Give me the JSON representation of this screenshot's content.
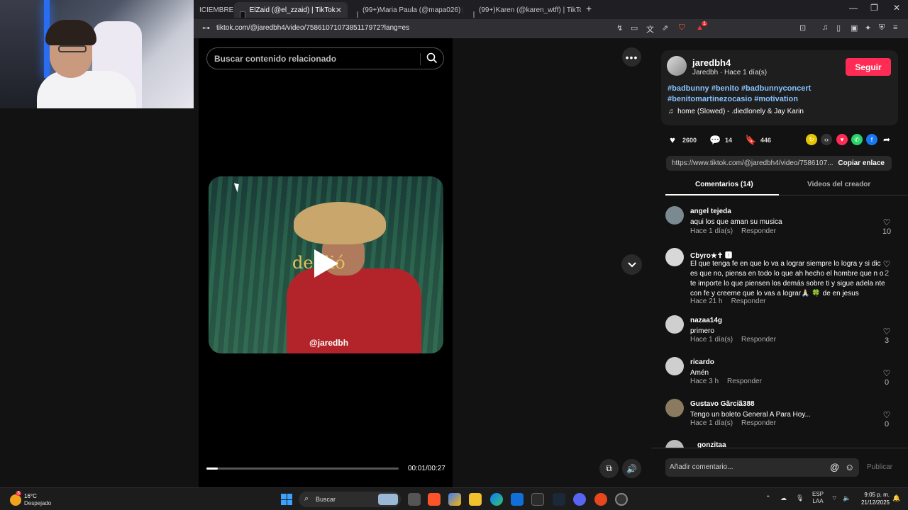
{
  "browser": {
    "tabs": [
      {
        "label": "ICIEMBRE ft."
      },
      {
        "label": "ElZaid (@el_zzaid) | TikTok"
      },
      {
        "label": "(99+)Maria Paula (@mapa026) | TikTo"
      },
      {
        "label": "(99+)Karen (@karen_wtff) | TikTok"
      }
    ],
    "new_tab": "+",
    "url": "tiktok.com/@jaredbh4/video/7586107107385117972?lang=es",
    "window": {
      "minimize": "—",
      "restore": "❐",
      "close": "✕"
    },
    "shield_badge": "1"
  },
  "left": {
    "search_placeholder": "Buscar contenido relacionado",
    "video": {
      "overlay_text": "de    dió",
      "handle": "@jaredbh",
      "time": "00:01/00:27",
      "progress": 0.06
    }
  },
  "post": {
    "username": "jaredbh4",
    "subtitle": "Jaredbh · Hace 1 día(s)",
    "follow_label": "Seguir",
    "hashtags": "#badbunny #benito #badbunnyconcert #benitomartinezocasio #motivation",
    "music": "home (Slowed) - .diedlonely & Jay Karin",
    "likes": "2600",
    "comments_count": "14",
    "saves": "446",
    "link": "https://www.tiktok.com/@jaredbh4/video/7586107...",
    "copy_label": "Copiar enlace",
    "tabs": {
      "comments": "Comentarios (14)",
      "videos": "Videos del creador"
    }
  },
  "comments": [
    {
      "name": "angel tejeda",
      "text": "aqui los que aman su musica",
      "time": "Hace 1 día(s)",
      "reply": "Responder",
      "likes": "10"
    },
    {
      "name": "Cbyro★✝ 🅸",
      "text": "El que tenga fe en que lo va a lograr siempre lo logra y si dic es que no, piensa en todo lo que ah hecho el hombre que n o te importe lo que piensen los demás sobre ti y sigue adela nte con fe y creeme que lo vas a lograr🙏🏻 🍀 de en jesus",
      "time": "Hace 21 h",
      "reply": "Responder",
      "likes": "2"
    },
    {
      "name": "nazaa14g",
      "text": "primero",
      "time": "Hace 1 día(s)",
      "reply": "Responder",
      "likes": "3"
    },
    {
      "name": "ricardo",
      "text": "Amén",
      "time": "Hace 3 h",
      "reply": "Responder",
      "likes": "0"
    },
    {
      "name": "Gustavo Gãrciã388",
      "text": "Tengo un boleto General A Para Hoy...",
      "time": "Hace 1 día(s)",
      "reply": "Responder",
      "likes": "0"
    },
    {
      "name": "gonzitaa",
      "text": "",
      "time": "",
      "reply": "",
      "likes": ""
    }
  ],
  "compose": {
    "placeholder": "Añadir comentario...",
    "at": "@",
    "emoji": "☺",
    "publish": "Publicar"
  },
  "taskbar": {
    "temp": "16°C",
    "weather": "Despejado",
    "weather_badge": "3",
    "search": "Buscar",
    "lang1": "ESP",
    "lang2": "LAA",
    "time": "9:05 p. m.",
    "date": "21/12/2025"
  }
}
